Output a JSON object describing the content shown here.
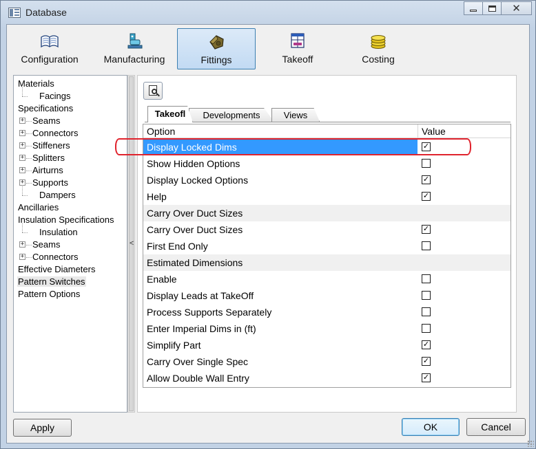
{
  "window": {
    "title": "Database"
  },
  "toolbar": {
    "items": [
      {
        "label": "Configuration",
        "icon": "book-icon",
        "active": false
      },
      {
        "label": "Manufacturing",
        "icon": "machine-icon",
        "active": false
      },
      {
        "label": "Fittings",
        "icon": "fittings-icon",
        "active": true
      },
      {
        "label": "Takeoff",
        "icon": "takeoff-icon",
        "active": false
      },
      {
        "label": "Costing",
        "icon": "coins-icon",
        "active": false
      }
    ]
  },
  "tree": {
    "items": [
      {
        "label": "Materials",
        "level": 0,
        "expander": false
      },
      {
        "label": "Facings",
        "level": 1,
        "expander": false
      },
      {
        "label": "Specifications",
        "level": 0,
        "expander": false
      },
      {
        "label": "Seams",
        "level": 1,
        "expander": true
      },
      {
        "label": "Connectors",
        "level": 1,
        "expander": true
      },
      {
        "label": "Stiffeners",
        "level": 1,
        "expander": true
      },
      {
        "label": "Splitters",
        "level": 1,
        "expander": true
      },
      {
        "label": "Airturns",
        "level": 1,
        "expander": true
      },
      {
        "label": "Supports",
        "level": 1,
        "expander": true
      },
      {
        "label": "Dampers",
        "level": 1,
        "expander": false
      },
      {
        "label": "Ancillaries",
        "level": 0,
        "expander": false
      },
      {
        "label": "Insulation Specifications",
        "level": 0,
        "expander": false
      },
      {
        "label": "Insulation",
        "level": 1,
        "expander": false
      },
      {
        "label": "Seams",
        "level": 1,
        "expander": true
      },
      {
        "label": "Connectors",
        "level": 1,
        "expander": true
      },
      {
        "label": "Effective Diameters",
        "level": 0,
        "expander": false
      },
      {
        "label": "Pattern Switches",
        "level": 0,
        "expander": false,
        "selected": true
      },
      {
        "label": "Pattern Options",
        "level": 0,
        "expander": false
      }
    ],
    "collapse_glyph": "<"
  },
  "tabs": [
    "Takeofl",
    "Developments",
    "Views"
  ],
  "grid": {
    "headers": {
      "option": "Option",
      "value": "Value"
    },
    "rows": [
      {
        "label": "Display Locked Dims",
        "checked": true,
        "selected": true
      },
      {
        "label": "Show Hidden Options",
        "checked": false
      },
      {
        "label": "Display Locked Options",
        "checked": true
      },
      {
        "label": "Help",
        "checked": true
      },
      {
        "label": "Carry Over Duct Sizes",
        "category": true
      },
      {
        "label": "Carry Over Duct Sizes",
        "checked": true
      },
      {
        "label": "First End Only",
        "checked": false
      },
      {
        "label": "Estimated Dimensions",
        "category": true
      },
      {
        "label": "Enable",
        "checked": false
      },
      {
        "label": "Display Leads at TakeOff",
        "checked": false
      },
      {
        "label": "Process Supports Separately",
        "checked": false
      },
      {
        "label": "Enter Imperial Dims in (ft)",
        "checked": false
      },
      {
        "label": "Simplify Part",
        "checked": true
      },
      {
        "label": "Carry Over Single Spec",
        "checked": true
      },
      {
        "label": "Allow Double Wall Entry",
        "checked": true
      }
    ]
  },
  "buttons": {
    "apply": "Apply",
    "ok": "OK",
    "cancel": "Cancel"
  },
  "colors": {
    "selection": "#3399ff",
    "highlight": "#e0222c",
    "active_tab_border": "#3c7fb1"
  }
}
